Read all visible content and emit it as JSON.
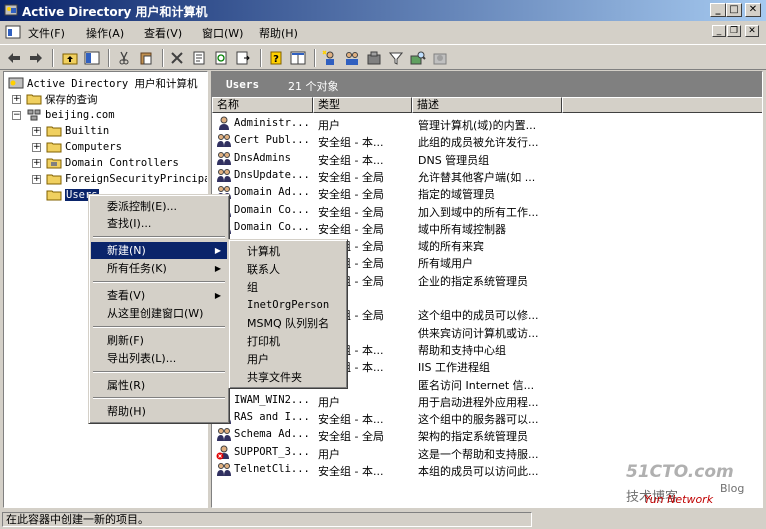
{
  "window": {
    "title": "Active Directory 用户和计算机",
    "caption_buttons": [
      "minimize",
      "maximize",
      "close"
    ]
  },
  "menubar": {
    "items": [
      "文件(F)",
      "操作(A)",
      "查看(V)",
      "窗口(W)",
      "帮助(H)"
    ]
  },
  "tree": {
    "root": "Active Directory 用户和计算机",
    "saved_queries": "保存的查询",
    "domain": "beijing.com",
    "children": [
      "Builtin",
      "Computers",
      "Domain Controllers",
      "ForeignSecurityPrincipal",
      "Users"
    ]
  },
  "list": {
    "header_title": "Users",
    "header_count": "21 个对象",
    "columns": [
      "名称",
      "类型",
      "描述"
    ],
    "rows": [
      {
        "name": "Administr...",
        "type": "用户",
        "desc": "管理计算机(域)的内置..."
      },
      {
        "name": "Cert Publ...",
        "type": "安全组 - 本...",
        "desc": "此组的成员被允许发行..."
      },
      {
        "name": "DnsAdmins",
        "type": "安全组 - 本...",
        "desc": "DNS 管理员组"
      },
      {
        "name": "DnsUpdate...",
        "type": "安全组 - 全局",
        "desc": "允许替其他客户端(如 ..."
      },
      {
        "name": "Domain Ad...",
        "type": "安全组 - 全局",
        "desc": "指定的域管理员"
      },
      {
        "name": "Domain Co...",
        "type": "安全组 - 全局",
        "desc": "加入到域中的所有工作..."
      },
      {
        "name": "Domain Co...",
        "type": "安全组 - 全局",
        "desc": "域中所有域控制器"
      },
      {
        "name": "",
        "type": "安全组 - 全局",
        "desc": "域的所有来宾"
      },
      {
        "name": "",
        "type": "安全组 - 全局",
        "desc": "所有域用户"
      },
      {
        "name": "",
        "type": "安全组 - 全局",
        "desc": "企业的指定系统管理员"
      },
      {
        "name": "",
        "type": "",
        "desc": ""
      },
      {
        "name": "",
        "type": "安全组 - 全局",
        "desc": "这个组中的成员可以修..."
      },
      {
        "name": "",
        "type": "",
        "desc": "供来宾访问计算机或访..."
      },
      {
        "name": "",
        "type": "安全组 - 本...",
        "desc": "帮助和支持中心组"
      },
      {
        "name": "",
        "type": "安全组 - 本...",
        "desc": "IIS 工作进程组"
      },
      {
        "name": "",
        "type": "",
        "desc": "匿名访问 Internet 信..."
      },
      {
        "name": "IWAM_WIN2...",
        "type": "用户",
        "desc": "用于启动进程外应用程..."
      },
      {
        "name": "RAS and I...",
        "type": "安全组 - 本...",
        "desc": "这个组中的服务器可以..."
      },
      {
        "name": "Schema Ad...",
        "type": "安全组 - 全局",
        "desc": "架构的指定系统管理员"
      },
      {
        "name": "SUPPORT_3...",
        "type": "用户",
        "desc": "这是一个帮助和支持服..."
      },
      {
        "name": "TelnetCli...",
        "type": "安全组 - 本...",
        "desc": "本组的成员可以访问此..."
      }
    ]
  },
  "context_menu": {
    "items": [
      "委派控制(E)...",
      "查找(I)...",
      "新建(N)",
      "所有任务(K)",
      "查看(V)",
      "从这里创建窗口(W)",
      "刷新(F)",
      "导出列表(L)...",
      "属性(R)",
      "帮助(H)"
    ]
  },
  "submenu": {
    "items": [
      "计算机",
      "联系人",
      "组",
      "InetOrgPerson",
      "MSMQ 队列别名",
      "打印机",
      "用户",
      "共享文件夹"
    ]
  },
  "status": {
    "text": "在此容器中创建一新的项目。"
  },
  "watermark": {
    "line1": "51CTO.com",
    "line2": "技术博客",
    "line3": "Blog",
    "line4": "Yun Network"
  },
  "colors": {
    "title_start": "#0a246a",
    "title_end": "#a6caf0",
    "selection": "#0a246a",
    "face": "#d4d0c8"
  }
}
